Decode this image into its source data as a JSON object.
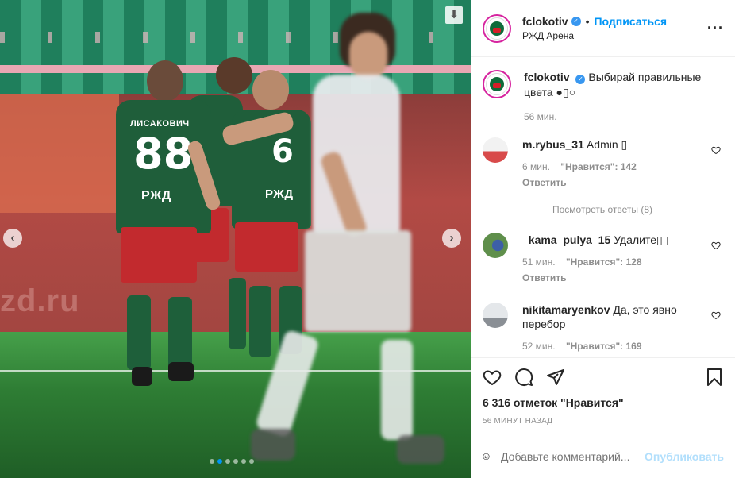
{
  "post": {
    "author": "fclokotiv",
    "follow_label": "Подписаться",
    "separator": "•",
    "location": "РЖД Арена",
    "more_icon": "more-horizontal-icon",
    "caption_text": "Выбирай правильные цвета ●▯○",
    "caption_time": "56 мин."
  },
  "photo": {
    "board_text": "zd.ru",
    "player_left": {
      "name": "ЛИСАКОВИЧ",
      "number": "88",
      "sponsor": "РЖД"
    },
    "player_right": {
      "number": "6",
      "sponsor": "РЖД"
    },
    "colors": {
      "home_shirt": "#1f5e3a",
      "home_shorts": "#c22a2e",
      "away_kit": "#e9ecef"
    },
    "carousel_total": 6,
    "carousel_active": 2
  },
  "comments": [
    {
      "user": "m.rybus_31",
      "text": "Admin ▯",
      "time": "6 мин.",
      "likes": "\"Нравится\": 142",
      "reply": "Ответить",
      "view_replies": "Посмотреть ответы (8)"
    },
    {
      "user": "_kama_pulya_15",
      "text": "Удалите▯▯",
      "time": "51 мин.",
      "likes": "\"Нравится\": 128",
      "reply": "Ответить"
    },
    {
      "user": "nikitamaryenkov",
      "text": "Да, это явно перебор",
      "time": "52 мин.",
      "likes": "\"Нравится\": 169"
    }
  ],
  "actions": {
    "likes_count": "6 316 отметок \"Нравится\"",
    "posted_ago": "56 МИНУТ НАЗАД"
  },
  "add_comment": {
    "placeholder": "Добавьте комментарий...",
    "publish_label": "Опубликовать"
  },
  "accent_color": "#0095f6"
}
